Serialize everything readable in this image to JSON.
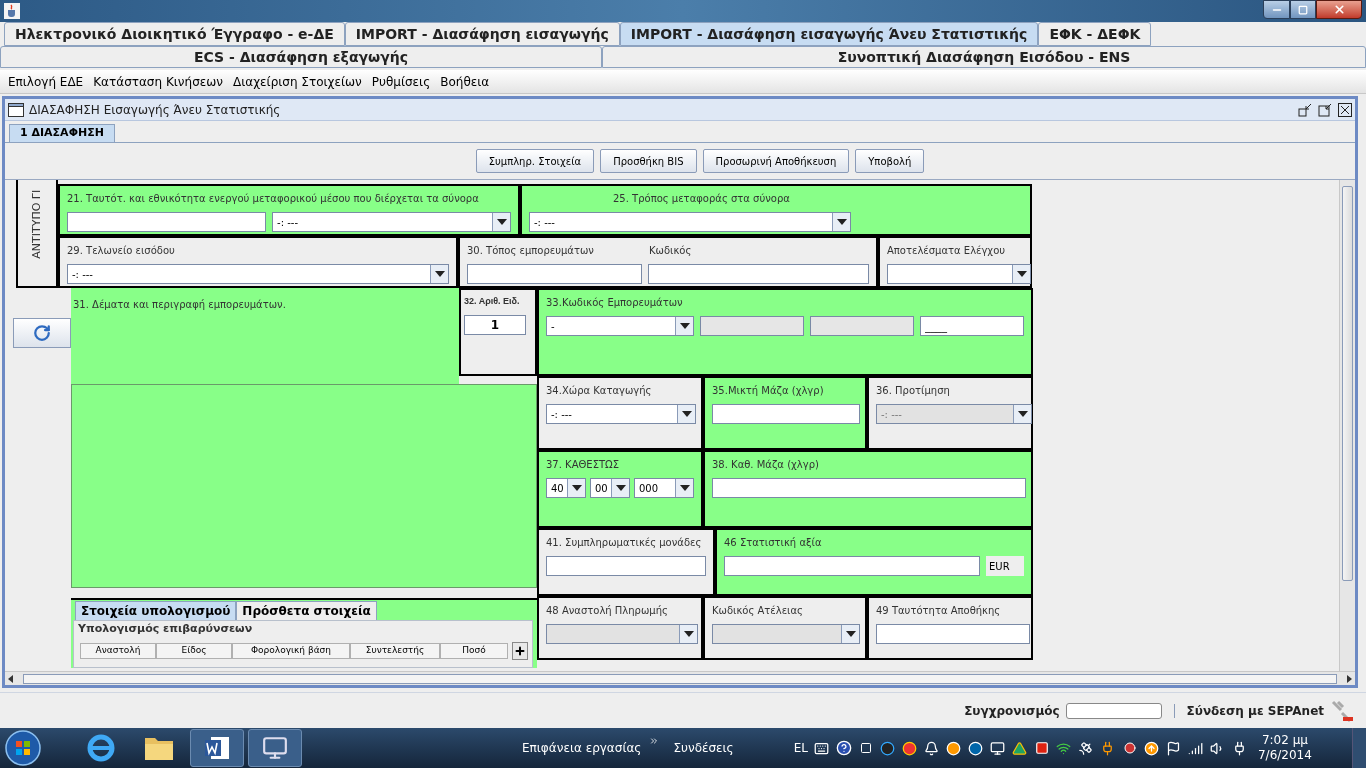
{
  "module_tab_rows": [
    {
      "tabs": [
        {
          "label": "Ηλεκτρονικό Διοικητικό Έγγραφο - e-ΔΕ",
          "selected": false
        },
        {
          "label": "IMPORT - Διασάφηση εισαγωγής",
          "selected": false
        },
        {
          "label": "IMPORT - Διασάφηση εισαγωγής Άνευ Στατιστικής",
          "selected": true
        },
        {
          "label": "ΕΦΚ - ΔΕΦΚ",
          "selected": false
        }
      ]
    },
    {
      "tabs": [
        {
          "label": "ECS - Διασάφηση εξαγωγής",
          "selected": false
        },
        {
          "label": "Συνοπτική Διασάφηση Εισόδου - ENS",
          "selected": false
        }
      ]
    }
  ],
  "menu": [
    "Επιλογή ΕΔΕ",
    "Κατάσταση Κινήσεων",
    "Διαχείριση Στοιχείων",
    "Ρυθμίσεις",
    "Βοήθεια"
  ],
  "internal_frame": {
    "title": "ΔΙΑΣΑΦΗΣΗ Εισαγωγής Άνευ Στατιστικής"
  },
  "form_tabs": [
    {
      "label": "1 ΔΙΑΣΑΦΗΣΗ",
      "selected": true
    }
  ],
  "toolbar": [
    "Συμπληρ. Στοιχεία",
    "Προσθήκη BIS",
    "Προσωρινή Αποθήκευση",
    "Υποβολή"
  ],
  "side_label": "ΑΝΤΙΤΥΠΟ ΓΙ",
  "box_21": {
    "label": "21. Ταυτότ. και εθνικότητα ενεργού μεταφορικού μέσου που διέρχεται τα σύνορα",
    "combo_value": "-: ---"
  },
  "box_25": {
    "label": "25. Τρόπος μεταφοράς στα σύνορα",
    "combo_value": "-: ---"
  },
  "box_29": {
    "label": "29. Τελωνείο εισόδου",
    "combo_value": "-: ---"
  },
  "box_30": {
    "label": "30. Τόπος εμπορευμάτων",
    "code_label": "Κωδικός"
  },
  "control_results": {
    "label": "Αποτελέσματα Ελέγχου"
  },
  "box_31": {
    "label": "31. Δέματα και περιγραφή εμπορευμάτων."
  },
  "box_32": {
    "label": "32. Αριθ. Ειδ.",
    "value": "1"
  },
  "box_33": {
    "label": "33.Κωδικός Εμπορευμάτων",
    "fields": [
      {
        "kind": "combo",
        "value": "-",
        "disabled": false
      },
      {
        "kind": "text",
        "disabled": true
      },
      {
        "kind": "text",
        "disabled": true
      },
      {
        "kind": "text",
        "value": "____",
        "disabled": false
      }
    ]
  },
  "box_34": {
    "label": "34.Χώρα Καταγωγής",
    "combo_value": "-: ---",
    "disabled": false
  },
  "box_35": {
    "label": "35.Μικτή Μάζα (χλγρ)"
  },
  "box_36": {
    "label": "36. Προτίμηση",
    "combo_value": "-: ---",
    "disabled": true
  },
  "box_37": {
    "label": "37. ΚΑΘΕΣΤΩΣ",
    "combos": [
      "40",
      "00",
      "000"
    ]
  },
  "box_38": {
    "label": "38. Καθ. Μάζα (χλγρ)"
  },
  "box_41": {
    "label": "41. Συμπληρωματικές μονάδες"
  },
  "box_46": {
    "label": "46 Στατιστική αξία",
    "currency": "EUR"
  },
  "box_48": {
    "label": "48 Αναστολή Πληρωμής",
    "disabled": true
  },
  "exemption_code": {
    "label": "Κωδικός Ατέλειας",
    "disabled": true
  },
  "box_49": {
    "label": "49 Ταυτότητα Αποθήκης"
  },
  "calc_tabs": [
    {
      "label": "Στοιχεία υπολογισμού",
      "selected": true
    },
    {
      "label": "Πρόσθετα στοιχεία",
      "selected": false
    }
  ],
  "charges_group": {
    "title": "Υπολογισμός επιβαρύνσεων",
    "columns": [
      "Αναστολή",
      "Είδος",
      "Φορολογική βάση",
      "Συντελεστής",
      "Ποσό"
    ]
  },
  "status_bar": {
    "sync_label": "Συγχρονισμός",
    "connection": "Σύνδεση με SEPAnet"
  },
  "taskbar": {
    "toolbars": [
      "Επιφάνεια εργασίας",
      "Συνδέσεις"
    ],
    "language": "EL",
    "time": "7:02 μμ",
    "date": "7/6/2014"
  }
}
